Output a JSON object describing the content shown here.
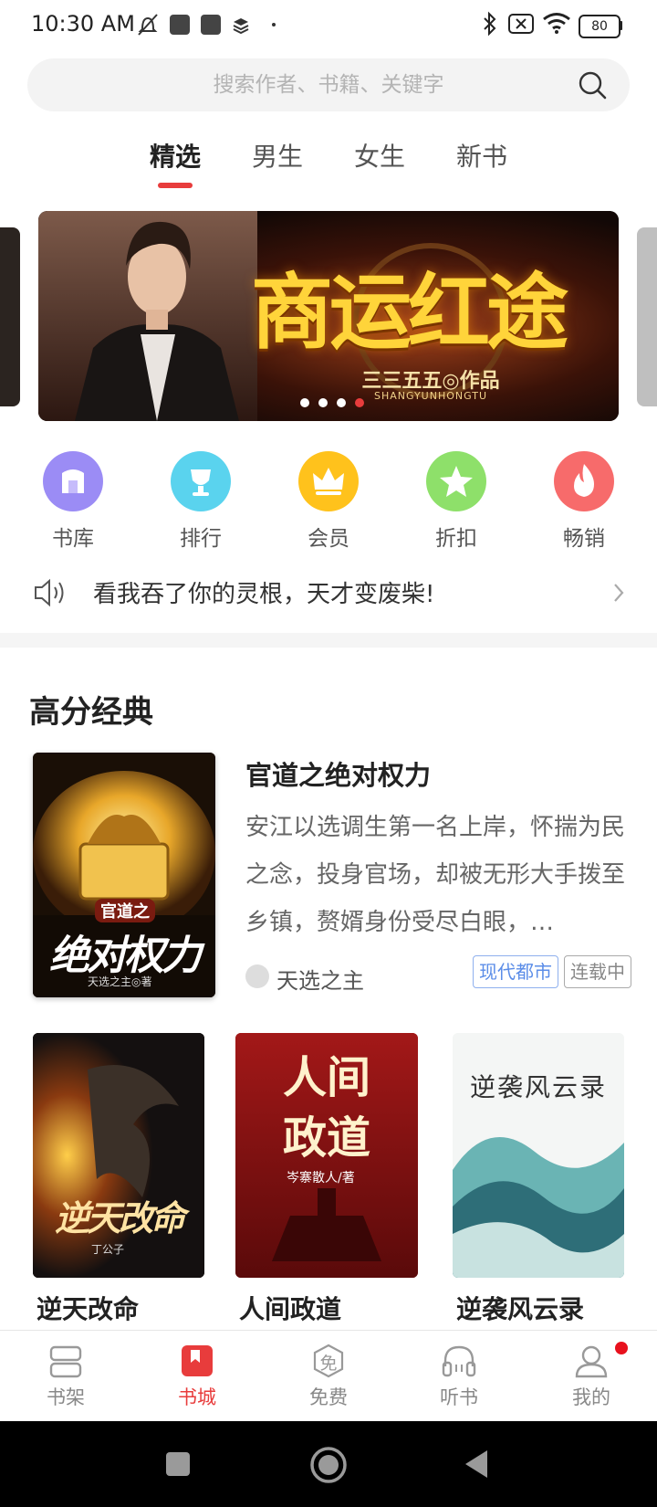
{
  "status_bar": {
    "time": "10:30 AM",
    "battery": "80",
    "icons": [
      "mute-icon",
      "app-icon",
      "app-icon",
      "layers-icon",
      "dot-icon",
      "bluetooth-icon",
      "sim-icon",
      "wifi-icon",
      "battery-icon"
    ]
  },
  "search": {
    "placeholder": "搜索作者、书籍、关键字"
  },
  "tabs": [
    {
      "label": "精选",
      "active": true
    },
    {
      "label": "男生",
      "active": false
    },
    {
      "label": "女生",
      "active": false
    },
    {
      "label": "新书",
      "active": false
    }
  ],
  "banner": {
    "title": "商运红途",
    "author": "三三五五◎作品",
    "pinyin": "SHANGYUNHONGTU",
    "pages": 4,
    "active_page": 4
  },
  "quick_menu": [
    {
      "label": "书库",
      "icon": "library-icon",
      "color": "#9b8cf5"
    },
    {
      "label": "排行",
      "icon": "trophy-icon",
      "color": "#5ad3ee"
    },
    {
      "label": "会员",
      "icon": "crown-icon",
      "color": "#ffc21c"
    },
    {
      "label": "折扣",
      "icon": "star-icon",
      "color": "#8ee06a"
    },
    {
      "label": "畅销",
      "icon": "fire-icon",
      "color": "#f76b6b"
    }
  ],
  "notice": {
    "text": "看我吞了你的灵根，天才变废柴!"
  },
  "section": {
    "title": "高分经典"
  },
  "featured": {
    "title": "官道之绝对权力",
    "description": "安江以选调生第一名上岸，怀揣为民之念，投身官场，却被无形大手拨至乡镇，赘婿身份受尽白眼，…",
    "author": "天选之主",
    "tags": [
      "现代都市",
      "连载中"
    ],
    "cover_text": "绝对权力",
    "cover_small": "官道之",
    "cover_author": "天选之主◎著"
  },
  "books": [
    {
      "title": "逆天改命",
      "cover_text": "逆天改命",
      "cover_author": "丁公子"
    },
    {
      "title": "人间政道",
      "cover_text": "人间政道",
      "cover_author": "岑寨散人/著"
    },
    {
      "title": "逆袭风云录",
      "cover_text": "逆袭风云录"
    }
  ],
  "bottom_nav": [
    {
      "label": "书架",
      "icon": "bookshelf-icon",
      "active": false
    },
    {
      "label": "书城",
      "icon": "bookstore-icon",
      "active": true
    },
    {
      "label": "免费",
      "icon": "free-icon",
      "active": false,
      "icon_text": "免"
    },
    {
      "label": "听书",
      "icon": "headphones-icon",
      "active": false
    },
    {
      "label": "我的",
      "icon": "profile-icon",
      "active": false,
      "badge": true
    }
  ],
  "colors": {
    "accent": "#e83c3c",
    "tag_blue": "#5b8de8"
  }
}
